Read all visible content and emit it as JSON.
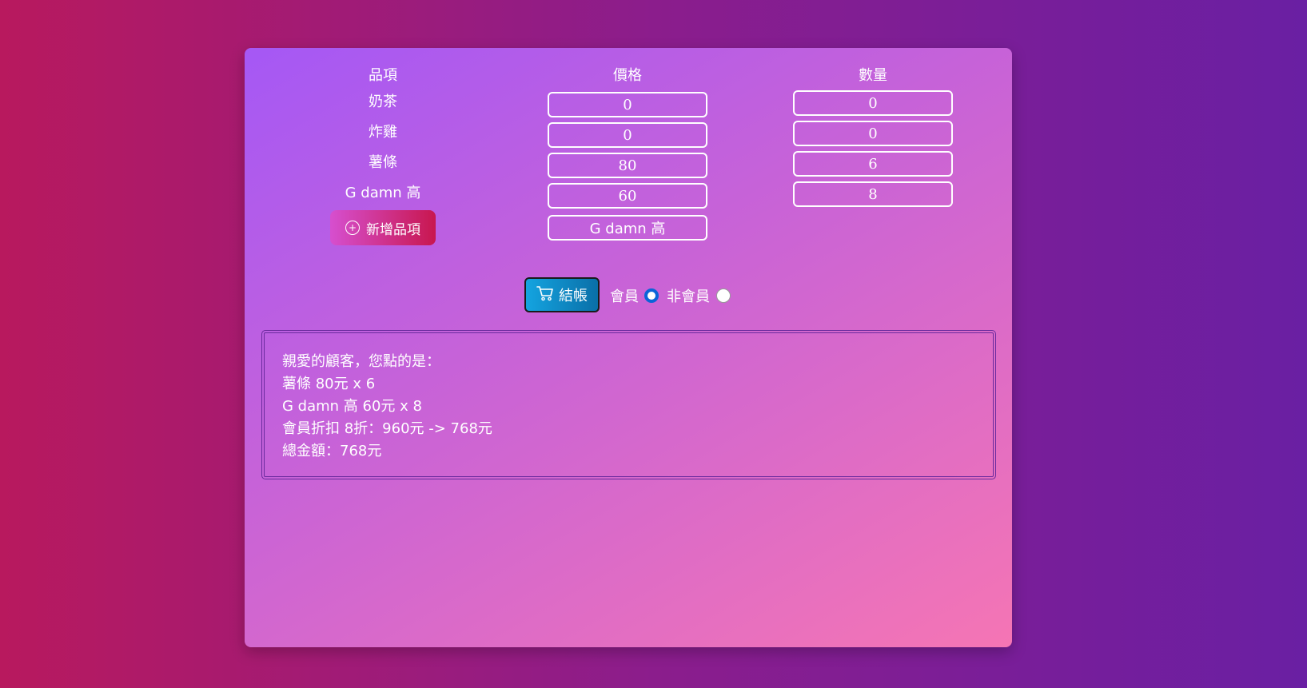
{
  "table": {
    "headers": {
      "item": "品項",
      "price": "價格",
      "qty": "數量"
    },
    "rows": [
      {
        "name": "奶茶",
        "price": "0",
        "qty": "0"
      },
      {
        "name": "炸雞",
        "price": "0",
        "qty": "0"
      },
      {
        "name": "薯條",
        "price": "80",
        "qty": "6"
      },
      {
        "name": "G damn 高",
        "price": "60",
        "qty": "8"
      }
    ],
    "new_item_value": "G damn 高",
    "add_button_label": "新增品項"
  },
  "checkout": {
    "button_label": "結帳",
    "member_label": "會員",
    "non_member_label": "非會員",
    "selected": "member"
  },
  "result": {
    "lines": [
      "親愛的顧客，您點的是：",
      "薯條 80元 x 6",
      "G damn 高 60元 x 8",
      "會員折扣 8折：960元 -> 768元",
      "總金額：768元"
    ]
  },
  "icons": {
    "add": "plus-circle-icon",
    "cart": "cart-icon"
  },
  "colors": {
    "accent_blue": "#14a4e0",
    "add_button": "#c8174f"
  }
}
